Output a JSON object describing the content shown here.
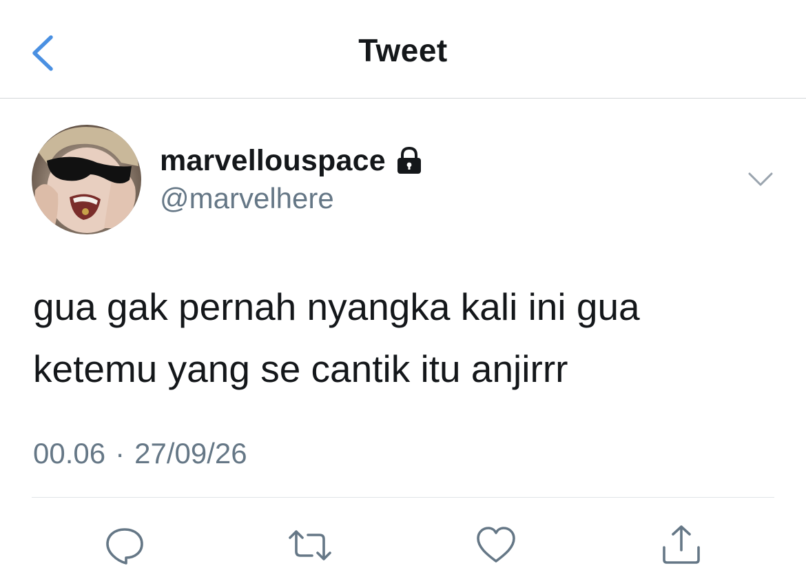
{
  "header": {
    "title": "Tweet",
    "back_icon": "chevron-left-icon",
    "accent_color": "#4a90e2"
  },
  "tweet": {
    "display_name": "marvellouspace",
    "protected_icon": "lock-icon",
    "username": "@marvelhere",
    "text_lines": [
      "gua gak pernah nyangka kali ini gua",
      "ketemu yang se cantik itu anjirrr"
    ],
    "time": "00.06",
    "separator": "·",
    "date": "27/09/26",
    "more_icon": "chevron-down-icon"
  },
  "actions": [
    {
      "icon": "reply-icon"
    },
    {
      "icon": "retweet-icon"
    },
    {
      "icon": "like-icon"
    },
    {
      "icon": "share-icon"
    }
  ],
  "colors": {
    "text_primary": "#14171a",
    "text_secondary": "#657786",
    "divider": "#e1e4e7",
    "icon_gray": "#657786"
  }
}
